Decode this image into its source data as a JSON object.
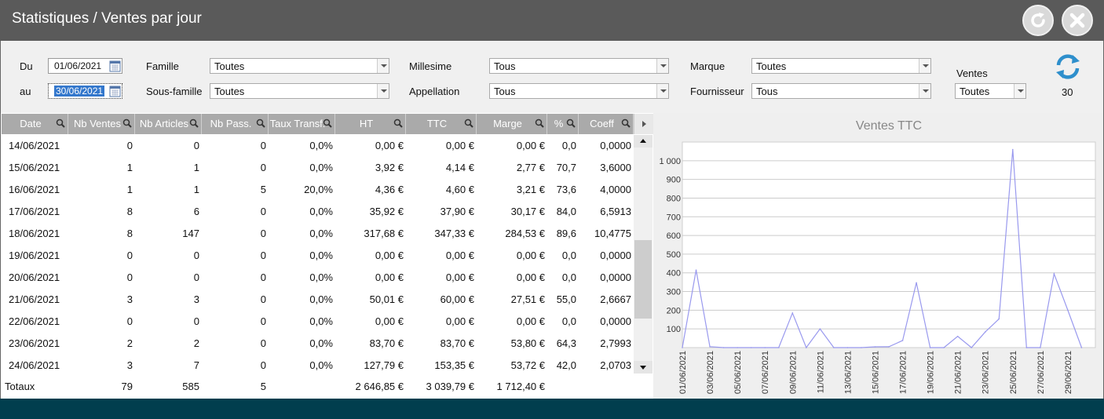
{
  "window": {
    "title": "Statistiques / Ventes par jour"
  },
  "filters": {
    "du_label": "Du",
    "du_value": "01/06/2021",
    "au_label": "au",
    "au_value": "30/06/2021",
    "famille_label": "Famille",
    "famille_value": "Toutes",
    "sous_famille_label": "Sous-famille",
    "sous_famille_value": "Toutes",
    "millesime_label": "Millesime",
    "millesime_value": "Tous",
    "appellation_label": "Appellation",
    "appellation_value": "Tous",
    "marque_label": "Marque",
    "marque_value": "Toutes",
    "fournisseur_label": "Fournisseur",
    "fournisseur_value": "Tous",
    "ventes_label": "Ventes",
    "ventes_value": "Toutes",
    "count": "30"
  },
  "table": {
    "columns": [
      "Date",
      "Nb Ventes",
      "Nb Articles",
      "Nb Pass.",
      "Taux Transf.",
      "HT",
      "TTC",
      "Marge",
      "%",
      "Coeff"
    ],
    "rows": [
      [
        "14/06/2021",
        "0",
        "0",
        "0",
        "0,0%",
        "0,00 €",
        "0,00 €",
        "0,00 €",
        "0,0",
        "0,0000"
      ],
      [
        "15/06/2021",
        "1",
        "1",
        "0",
        "0,0%",
        "3,92 €",
        "4,14 €",
        "2,77 €",
        "70,7",
        "3,6000"
      ],
      [
        "16/06/2021",
        "1",
        "1",
        "5",
        "20,0%",
        "4,36 €",
        "4,60 €",
        "3,21 €",
        "73,6",
        "4,0000"
      ],
      [
        "17/06/2021",
        "8",
        "6",
        "0",
        "0,0%",
        "35,92 €",
        "37,90 €",
        "30,17 €",
        "84,0",
        "6,5913"
      ],
      [
        "18/06/2021",
        "8",
        "147",
        "0",
        "0,0%",
        "317,68 €",
        "347,33 €",
        "284,53 €",
        "89,6",
        "10,4775"
      ],
      [
        "19/06/2021",
        "0",
        "0",
        "0",
        "0,0%",
        "0,00 €",
        "0,00 €",
        "0,00 €",
        "0,0",
        "0,0000"
      ],
      [
        "20/06/2021",
        "0",
        "0",
        "0",
        "0,0%",
        "0,00 €",
        "0,00 €",
        "0,00 €",
        "0,0",
        "0,0000"
      ],
      [
        "21/06/2021",
        "3",
        "3",
        "0",
        "0,0%",
        "50,01 €",
        "60,00 €",
        "27,51 €",
        "55,0",
        "2,6667"
      ],
      [
        "22/06/2021",
        "0",
        "0",
        "0",
        "0,0%",
        "0,00 €",
        "0,00 €",
        "0,00 €",
        "0,0",
        "0,0000"
      ],
      [
        "23/06/2021",
        "2",
        "2",
        "0",
        "0,0%",
        "83,70 €",
        "83,70 €",
        "53,80 €",
        "64,3",
        "2,7993"
      ],
      [
        "24/06/2021",
        "3",
        "7",
        "0",
        "0,0%",
        "127,79 €",
        "153,35 €",
        "53,72 €",
        "42,0",
        "2,0703"
      ]
    ],
    "totals": [
      "Totaux",
      "79",
      "585",
      "5",
      "",
      "2 646,85 €",
      "3 039,79 €",
      "1 712,40 €",
      "",
      ""
    ]
  },
  "chart_data": {
    "type": "line",
    "title": "Ventes TTC",
    "x": [
      "01/06/2021",
      "02/06/2021",
      "03/06/2021",
      "04/06/2021",
      "05/06/2021",
      "06/06/2021",
      "07/06/2021",
      "08/06/2021",
      "09/06/2021",
      "10/06/2021",
      "11/06/2021",
      "12/06/2021",
      "13/06/2021",
      "14/06/2021",
      "15/06/2021",
      "16/06/2021",
      "17/06/2021",
      "18/06/2021",
      "19/06/2021",
      "20/06/2021",
      "21/06/2021",
      "22/06/2021",
      "23/06/2021",
      "24/06/2021",
      "25/06/2021",
      "26/06/2021",
      "27/06/2021",
      "28/06/2021",
      "29/06/2021",
      "30/06/2021"
    ],
    "x_tick_labels": [
      "01/06/2021",
      "03/06/2021",
      "05/06/2021",
      "07/06/2021",
      "09/06/2021",
      "11/06/2021",
      "13/06/2021",
      "15/06/2021",
      "17/06/2021",
      "19/06/2021",
      "21/06/2021",
      "23/06/2021",
      "25/06/2021",
      "27/06/2021",
      "29/06/2021"
    ],
    "series": [
      {
        "values": [
          0,
          415,
          5,
          0,
          0,
          0,
          0,
          0,
          185,
          0,
          100,
          0,
          0,
          0,
          4.14,
          4.6,
          37.9,
          347.33,
          0,
          0,
          60.0,
          0,
          83.7,
          153.35,
          1060,
          0,
          0,
          395,
          200,
          0
        ]
      }
    ],
    "y_ticks": [
      "100",
      "200",
      "300",
      "400",
      "500",
      "600",
      "700",
      "800",
      "900",
      "1 000"
    ],
    "ylim": [
      0,
      1100
    ],
    "grid": true,
    "legend": "none",
    "line_color": "#9999ee"
  },
  "colors": {
    "titlebar": "#5a5a5a",
    "header": "#aaaaaa",
    "footer": "#013e4e",
    "refresh": "#2e8fcc"
  }
}
